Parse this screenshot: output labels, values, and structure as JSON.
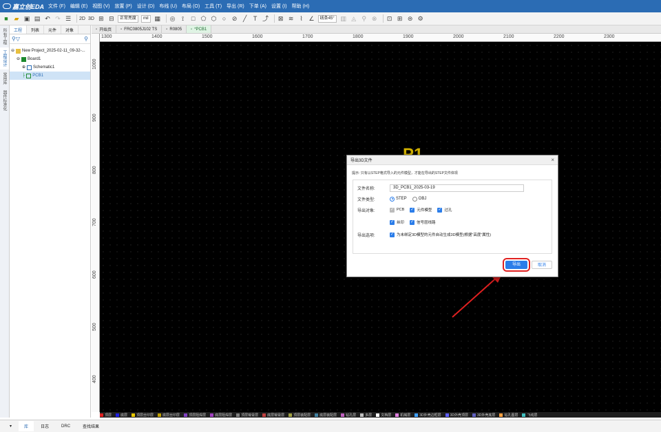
{
  "app": {
    "name": "嘉立创EDA"
  },
  "menu": [
    "文件 (F)",
    "编辑 (E)",
    "视图 (V)",
    "放置 (P)",
    "设计 (D)",
    "布线 (U)",
    "布局 (O)",
    "工具 (T)",
    "导出 (R)",
    "下单 (A)",
    "设置 (I)",
    "帮助 (H)"
  ],
  "toolbar": {
    "view2d": "2D",
    "view3d": "3D",
    "layer_select": "正常亮度",
    "unit_select": "mil",
    "angle_select": "线条45°"
  },
  "left_tabs": [
    "所有工程",
    "工程设计",
    "常用库",
    "器件标准化"
  ],
  "panel": {
    "tabs": [
      "工程",
      "列表",
      "元件",
      "对象"
    ],
    "tree": [
      {
        "label": "New Project_2025-02-11_09-32-..."
      },
      {
        "label": "Board1"
      },
      {
        "label": "Schematic1"
      },
      {
        "label": "PCB1"
      }
    ]
  },
  "doc_tabs": [
    "开始页",
    "FRC0805J102 TS",
    "R0805",
    "*PCB1"
  ],
  "ruler": {
    "h": [
      "1300",
      "1400",
      "1500",
      "1600",
      "1700",
      "1800",
      "1900",
      "2000",
      "2100",
      "2200",
      "2300"
    ],
    "v": [
      "1000",
      "900",
      "800",
      "700",
      "600",
      "500",
      "400"
    ]
  },
  "canvas": {
    "watermark": "P1"
  },
  "layers": [
    {
      "n": "顶层",
      "c": "#e02020"
    },
    {
      "n": "底层",
      "c": "#2020e0"
    },
    {
      "n": "顶层丝印层",
      "c": "#e8c800"
    },
    {
      "n": "底层丝印层",
      "c": "#c0a000"
    },
    {
      "n": "顶层阻焊层",
      "c": "#8040c0"
    },
    {
      "n": "底层阻焊层",
      "c": "#a040c0"
    },
    {
      "n": "顶层锡膏层",
      "c": "#808080"
    },
    {
      "n": "底层锡膏层",
      "c": "#c04040"
    },
    {
      "n": "顶层装配层",
      "c": "#a0a040"
    },
    {
      "n": "底层装配层",
      "c": "#4080a0"
    },
    {
      "n": "钻孔层",
      "c": "#c060c0"
    },
    {
      "n": "多层",
      "c": "#c0c0c0"
    },
    {
      "n": "文档层",
      "c": "#ffffff"
    },
    {
      "n": "机械层",
      "c": "#e080e0"
    },
    {
      "n": "3D外壳边框层",
      "c": "#40a0ff"
    },
    {
      "n": "3D外壳顶层",
      "c": "#6060ff"
    },
    {
      "n": "3D外壳底层",
      "c": "#6060c0"
    },
    {
      "n": "钻孔图层",
      "c": "#ffa040"
    },
    {
      "n": "飞线层",
      "c": "#40c0c0"
    }
  ],
  "bottom_tabs": [
    "库",
    "日志",
    "DRC",
    "查找结果"
  ],
  "dialog": {
    "title": "导出3D文件",
    "close": "×",
    "hint": "提示: 只有以STEP格式导入的元件模型，才能在导出的STEP文件体现",
    "filename_label": "文件名称:",
    "filename_value": "3D_PCB1_2025-03-19",
    "filetype_label": "文件类型:",
    "filetype_options": [
      "STEP",
      "OBJ"
    ],
    "objects_label": "导出对象:",
    "objects": [
      "PCB",
      "元件模型",
      "过孔",
      "丝印",
      "信号层线路"
    ],
    "options_label": "导出选项:",
    "option_text": "为未绑定3D模型的元件自动生成3D模型(根据\"高度\"属性)",
    "export_button": "导出",
    "cancel_button": "取消"
  }
}
